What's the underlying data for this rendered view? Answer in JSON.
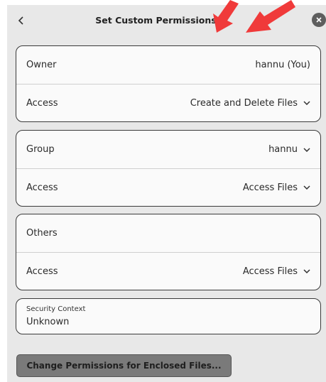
{
  "dialog": {
    "title": "Set Custom Permissions",
    "back_icon": "chevron-left-icon",
    "close_icon": "close-icon"
  },
  "owner": {
    "label": "Owner",
    "value": "hannu (You)",
    "access_label": "Access",
    "access_value": "Create and Delete Files"
  },
  "group": {
    "label": "Group",
    "value": "hannu",
    "access_label": "Access",
    "access_value": "Access Files"
  },
  "others": {
    "label": "Others",
    "access_label": "Access",
    "access_value": "Access Files"
  },
  "security_context": {
    "label": "Security Context",
    "value": "Unknown"
  },
  "buttons": {
    "change_enclosed": "Change Permissions for Enclosed Files..."
  },
  "annotation": {
    "arrow_color": "#f03a3a"
  },
  "colors": {
    "dialog_bg": "#e8e8e8",
    "card_bg": "#fafafa",
    "card_border": "#3a3a3a",
    "button_bg": "#7a7a7a"
  }
}
